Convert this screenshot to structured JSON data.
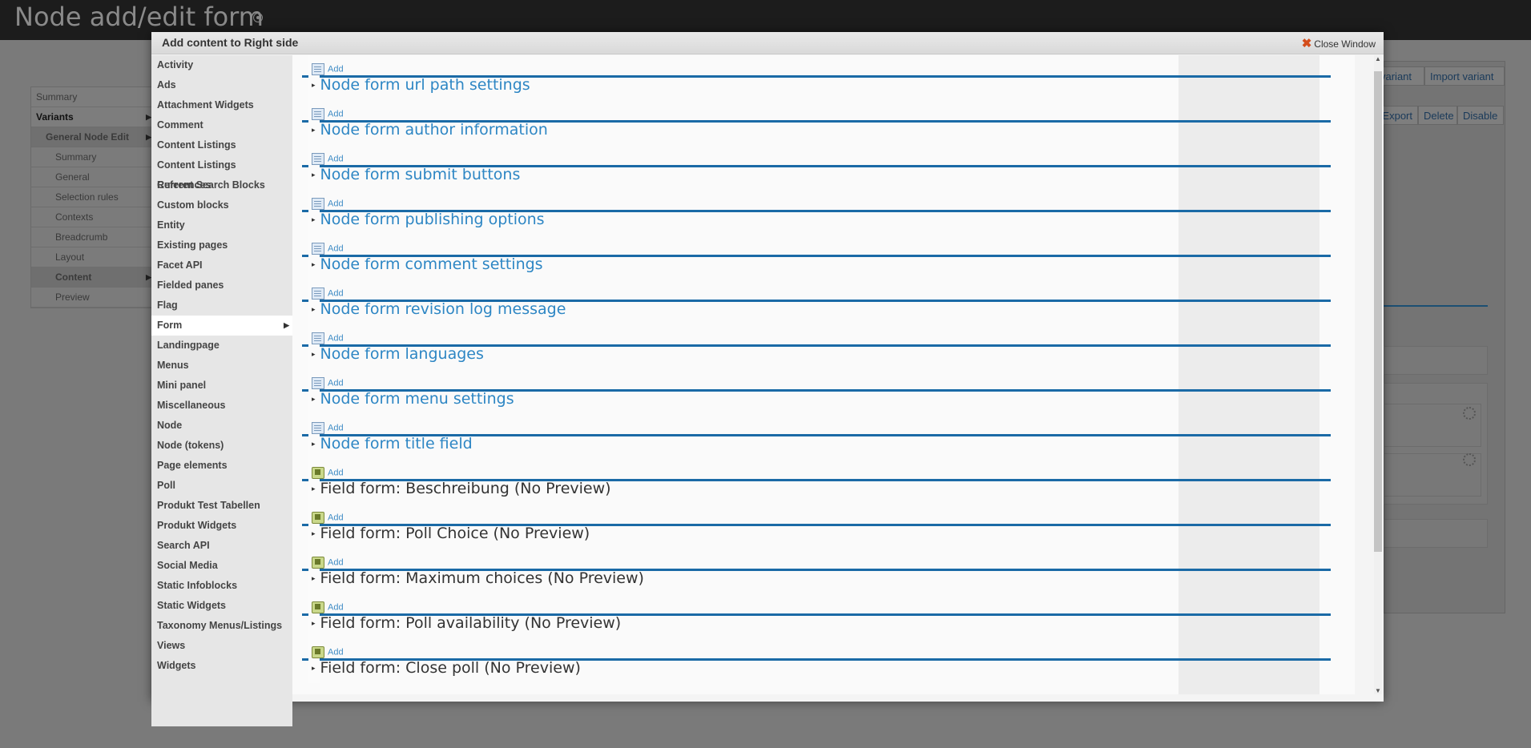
{
  "page": {
    "title": "Node add/edit form"
  },
  "bg_nav": {
    "summary": "Summary",
    "variants": "Variants",
    "general_node_edit": "General Node Edit",
    "sub": [
      "Summary",
      "General",
      "Selection rules",
      "Contexts",
      "Breadcrumb",
      "Layout",
      "Content",
      "Preview"
    ]
  },
  "bg_buttons": {
    "variant": "variant",
    "import_variant": "Import variant",
    "export": "Export",
    "delete": "Delete",
    "disable": "Disable"
  },
  "modal": {
    "title": "Add content to Right side",
    "close_label": "Close Window",
    "categories": [
      "Activity",
      "Ads",
      "Attachment Widgets",
      "Comment",
      "Content Listings",
      "Content Listings References",
      "Current Search Blocks",
      "Custom blocks",
      "Entity",
      "Existing pages",
      "Facet API",
      "Fielded panes",
      "Flag",
      "Form",
      "Landingpage",
      "Menus",
      "Mini panel",
      "Miscellaneous",
      "Node",
      "Node (tokens)",
      "Page elements",
      "Poll",
      "Produkt Test Tabellen",
      "Produkt Widgets",
      "Search API",
      "Social Media",
      "Static Infoblocks",
      "Static Widgets",
      "Taxonomy Menus/Listings",
      "Views",
      "Widgets"
    ],
    "active_category": "Form",
    "add_label": "Add",
    "content_types": [
      {
        "title": "Node form url path settings",
        "kind": "node"
      },
      {
        "title": "Node form author information",
        "kind": "node"
      },
      {
        "title": "Node form submit buttons",
        "kind": "node"
      },
      {
        "title": "Node form publishing options",
        "kind": "node"
      },
      {
        "title": "Node form comment settings",
        "kind": "node"
      },
      {
        "title": "Node form revision log message",
        "kind": "node"
      },
      {
        "title": "Node form languages",
        "kind": "node"
      },
      {
        "title": "Node form menu settings",
        "kind": "node"
      },
      {
        "title": "Node form title field",
        "kind": "node"
      },
      {
        "title": "Field form: Beschreibung (No Preview)",
        "kind": "field"
      },
      {
        "title": "Field form: Poll Choice (No Preview)",
        "kind": "field"
      },
      {
        "title": "Field form: Maximum choices (No Preview)",
        "kind": "field"
      },
      {
        "title": "Field form: Poll availability (No Preview)",
        "kind": "field"
      },
      {
        "title": "Field form: Close poll (No Preview)",
        "kind": "field"
      }
    ]
  },
  "colors": {
    "link": "#2d86c4",
    "rule": "#1a6aa6",
    "close_icon": "#d44d1b"
  }
}
